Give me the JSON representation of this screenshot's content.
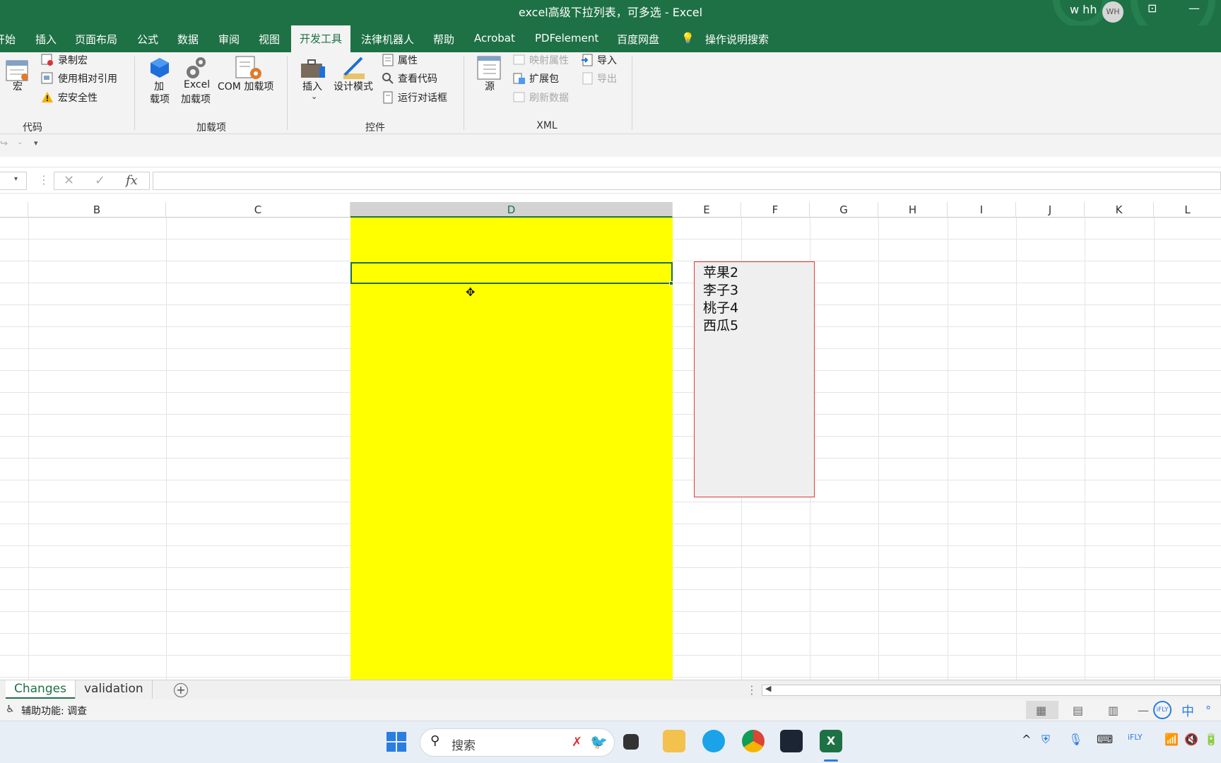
{
  "window": {
    "title": "excel高级下拉列表，可多选  -  Excel",
    "user_name": "w hh",
    "avatar_initials": "WH"
  },
  "ribbon_tabs": [
    "开始",
    "插入",
    "页面布局",
    "公式",
    "数据",
    "审阅",
    "视图",
    "开发工具",
    "法律机器人",
    "帮助",
    "Acrobat",
    "PDFelement",
    "百度网盘"
  ],
  "active_tab": "开发工具",
  "tell_me": "操作说明搜索",
  "ribbon": {
    "code": {
      "label": "代码",
      "macro": "宏",
      "record_macro": "录制宏",
      "relative_refs": "使用相对引用",
      "macro_security": "宏安全性"
    },
    "addins": {
      "label": "加载项",
      "addins_line1": "加",
      "addins_line2": "载项",
      "excel_addins_line1": "Excel",
      "excel_addins_line2": "加载项",
      "com_addins": "COM 加载项"
    },
    "controls": {
      "label": "控件",
      "insert": "插入",
      "design_mode": "设计模式",
      "properties": "属性",
      "view_code": "查看代码",
      "run_dialog": "运行对话框"
    },
    "xml": {
      "label": "XML",
      "source": "源",
      "map_properties": "映射属性",
      "expansion_packs": "扩展包",
      "refresh_data": "刷新数据",
      "import": "导入",
      "export": "导出"
    }
  },
  "formula_bar": {
    "cancel": "✕",
    "enter": "✓",
    "fx": "fx",
    "value": ""
  },
  "columns": [
    "B",
    "C",
    "D",
    "E",
    "F",
    "G",
    "H",
    "I",
    "J",
    "K",
    "L"
  ],
  "selected_column": "D",
  "highlight_color": "#ffff00",
  "listbox_items": [
    "苹果2",
    "李子3",
    "桃子4",
    "西瓜5"
  ],
  "sheets": [
    "Changes",
    "validation"
  ],
  "active_sheet": "Changes",
  "status": {
    "accessibility": "辅助功能: 调查"
  },
  "taskbar": {
    "search_placeholder": "搜索",
    "ime": "中"
  }
}
